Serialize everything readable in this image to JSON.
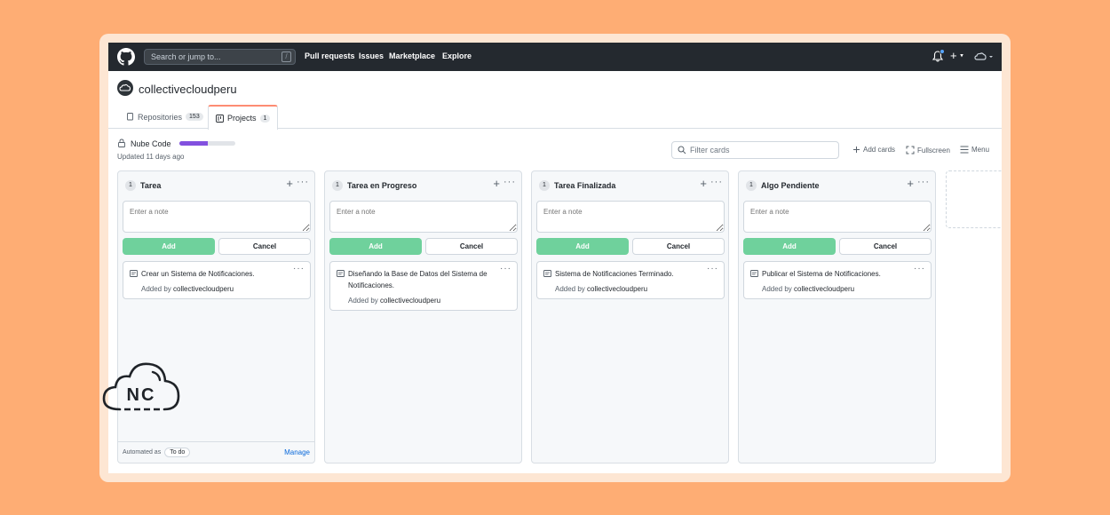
{
  "nav": {
    "search_placeholder": "Search or jump to...",
    "search_shortcut": "/",
    "links": [
      "Pull requests",
      "Issues",
      "Marketplace",
      "Explore"
    ],
    "plus": "+"
  },
  "org": {
    "name": "collectivecloudperu"
  },
  "tabs": [
    {
      "label": "Repositories",
      "count": "153"
    },
    {
      "label": "Projects",
      "count": "1"
    }
  ],
  "project": {
    "name": "Nube Code",
    "progress": 0.5,
    "updated": "Updated 11 days ago",
    "filter_placeholder": "Filter cards",
    "add_cards": "Add cards",
    "fullscreen": "Fullscreen",
    "menu": "Menu"
  },
  "labels": {
    "note_placeholder": "Enter a note",
    "add": "Add",
    "cancel": "Cancel",
    "added_by": "Added by",
    "automated_as": "Automated as",
    "todo": "To do",
    "manage": "Manage"
  },
  "columns": [
    {
      "count": "1",
      "title": "Tarea",
      "card": {
        "text": "Crear un Sistema de Notificaciones.",
        "author": "collectivecloudperu"
      }
    },
    {
      "count": "1",
      "title": "Tarea en Progreso",
      "card": {
        "text": "Diseñando la Base de Datos del Sistema de Notificaciones.",
        "author": "collectivecloudperu"
      }
    },
    {
      "count": "1",
      "title": "Tarea Finalizada",
      "card": {
        "text": "Sistema de Notificaciones Terminado.",
        "author": "collectivecloudperu"
      }
    },
    {
      "count": "1",
      "title": "Algo Pendiente",
      "card": {
        "text": "Publicar el Sistema de Notificaciones.",
        "author": "collectivecloudperu"
      }
    }
  ],
  "brand": {
    "logo_text": "NC"
  },
  "colors": {
    "nav_bg": "#24292f",
    "add_button": "#6fd19c",
    "progress": "#8250df",
    "page_bg": "#fead74"
  }
}
